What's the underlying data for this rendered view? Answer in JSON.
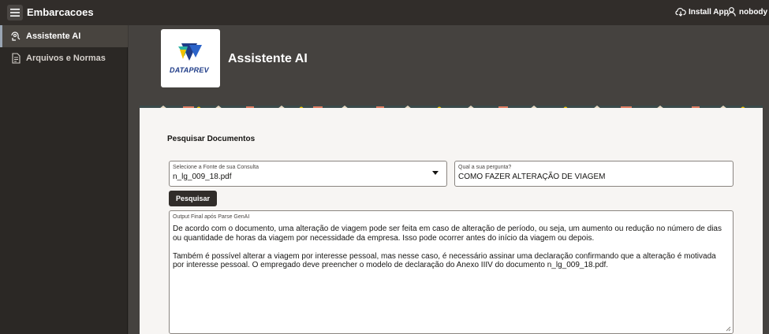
{
  "header": {
    "app_title": "Embarcacoes",
    "install_label": "Install App",
    "user_label": "nobody"
  },
  "sidebar": {
    "items": [
      {
        "label": "Assistente AI",
        "icon": "assistant-icon",
        "active": true
      },
      {
        "label": "Arquivos e Normas",
        "icon": "document-icon",
        "active": false
      }
    ]
  },
  "page": {
    "title": "Assistente AI",
    "logo_text": "DATAPREV"
  },
  "search": {
    "region_title": "Pesquisar Documentos",
    "source_label": "Selecione a Fonte de sua Consulta",
    "source_value": "n_lg_009_18.pdf",
    "question_label": "Qual a sua pergunta?",
    "question_value": "COMO FAZER ALTERAÇÃO DE VIAGEM",
    "button_label": "Pesquisar"
  },
  "output": {
    "label": "Output Final após Parse GenAI",
    "paragraphs": [
      "De acordo com o documento, uma alteração de viagem pode ser feita em caso de alteração de período, ou seja, um aumento ou redução no número de dias ou quantidade de horas da viagem por necessidade da empresa. Isso pode ocorrer antes do início da viagem ou depois.",
      "Também é possível alterar a viagem por interesse pessoal, mas nesse caso, é necessário assinar uma declaração confirmando que a alteração é motivada por interesse pessoal. O empregado deve preencher o modelo de declaração do Anexo IIIV do documento n_lg_009_18.pdf."
    ]
  },
  "colors": {
    "header_bg": "#312d2a",
    "sidebar_bg": "#2b2825",
    "main_bg": "#45423f",
    "region_bg": "#f7f5f3",
    "logo_blue": "#1f3c88",
    "logo_yellow": "#f2c200",
    "logo_teal": "#2bb3a3"
  }
}
